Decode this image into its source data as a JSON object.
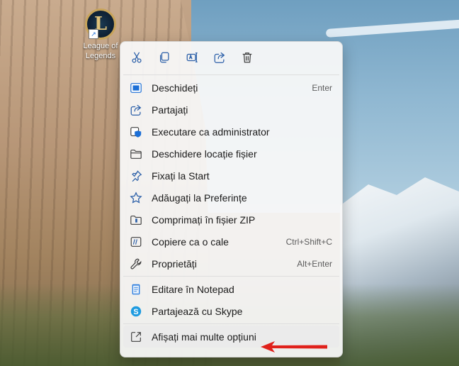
{
  "desktop": {
    "icon_label": "League of Legends",
    "icon_letter": "L"
  },
  "menu": {
    "quick_actions": [
      {
        "name": "cut-icon"
      },
      {
        "name": "copy-icon"
      },
      {
        "name": "rename-icon"
      },
      {
        "name": "share-icon"
      },
      {
        "name": "delete-icon"
      }
    ],
    "items": [
      {
        "label": "Deschideți",
        "shortcut": "Enter",
        "icon": "open-icon"
      },
      {
        "label": "Partajați",
        "shortcut": "",
        "icon": "share-icon"
      },
      {
        "label": "Executare ca administrator",
        "shortcut": "",
        "icon": "admin-shield-icon"
      },
      {
        "label": "Deschidere locație fișier",
        "shortcut": "",
        "icon": "folder-icon"
      },
      {
        "label": "Fixați la Start",
        "shortcut": "",
        "icon": "pin-icon"
      },
      {
        "label": "Adăugați la Preferințe",
        "shortcut": "",
        "icon": "star-icon"
      },
      {
        "label": "Comprimați în fișier ZIP",
        "shortcut": "",
        "icon": "zip-icon"
      },
      {
        "label": "Copiere ca o cale",
        "shortcut": "Ctrl+Shift+C",
        "icon": "copy-path-icon"
      },
      {
        "label": "Proprietăți",
        "shortcut": "Alt+Enter",
        "icon": "wrench-icon"
      }
    ],
    "apps": [
      {
        "label": "Editare în Notepad",
        "icon": "notepad-icon"
      },
      {
        "label": "Partajează cu Skype",
        "icon": "skype-icon"
      }
    ],
    "more": {
      "label": "Afișați mai multe opțiuni",
      "icon": "show-more-icon"
    }
  },
  "colors": {
    "accent": "#1c6fd6",
    "arrow": "#e0211b"
  }
}
